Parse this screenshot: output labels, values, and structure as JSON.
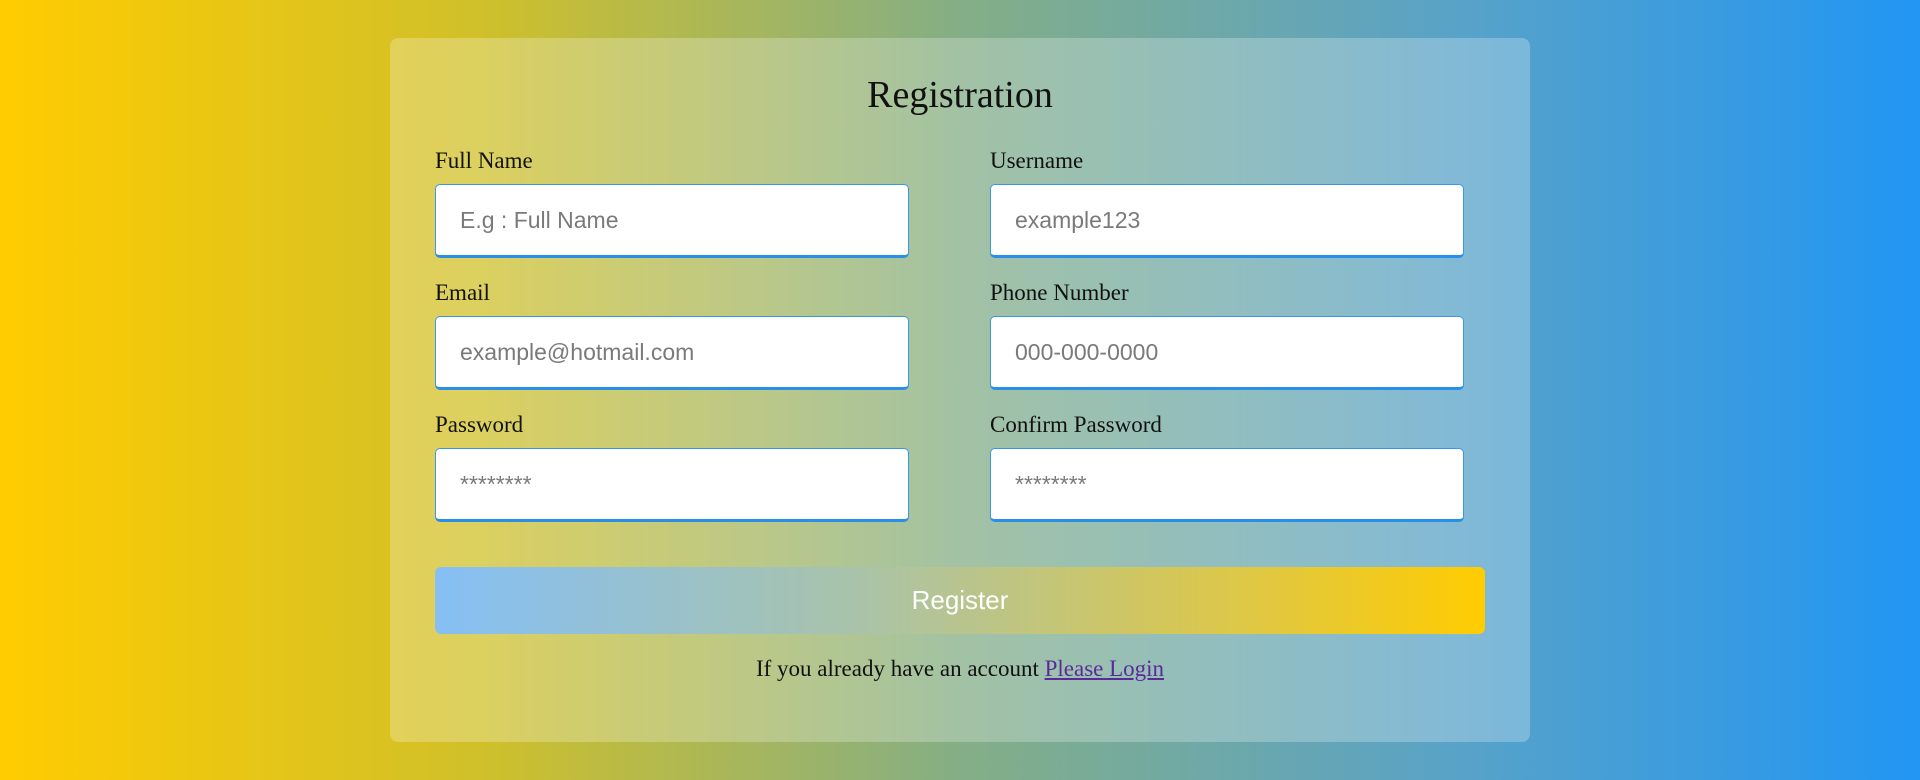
{
  "form": {
    "title": "Registration",
    "fields": {
      "full_name": {
        "label": "Full Name",
        "placeholder": "E.g : Full Name",
        "value": ""
      },
      "username": {
        "label": "Username",
        "placeholder": "example123",
        "value": ""
      },
      "email": {
        "label": "Email",
        "placeholder": "example@hotmail.com",
        "value": ""
      },
      "phone": {
        "label": "Phone Number",
        "placeholder": "000-000-0000",
        "value": ""
      },
      "password": {
        "label": "Password",
        "placeholder": "********",
        "value": ""
      },
      "confirm_password": {
        "label": "Confirm Password",
        "placeholder": "********",
        "value": ""
      }
    },
    "register_label": "Register",
    "login_prompt": "If you already have an account",
    "login_link": "Please Login"
  },
  "colors": {
    "background_start": "#ffcc00",
    "background_end": "#2196f3",
    "input_border": "#2a8fe6",
    "button_text": "#ffffff",
    "link": "#5b2a9a"
  }
}
